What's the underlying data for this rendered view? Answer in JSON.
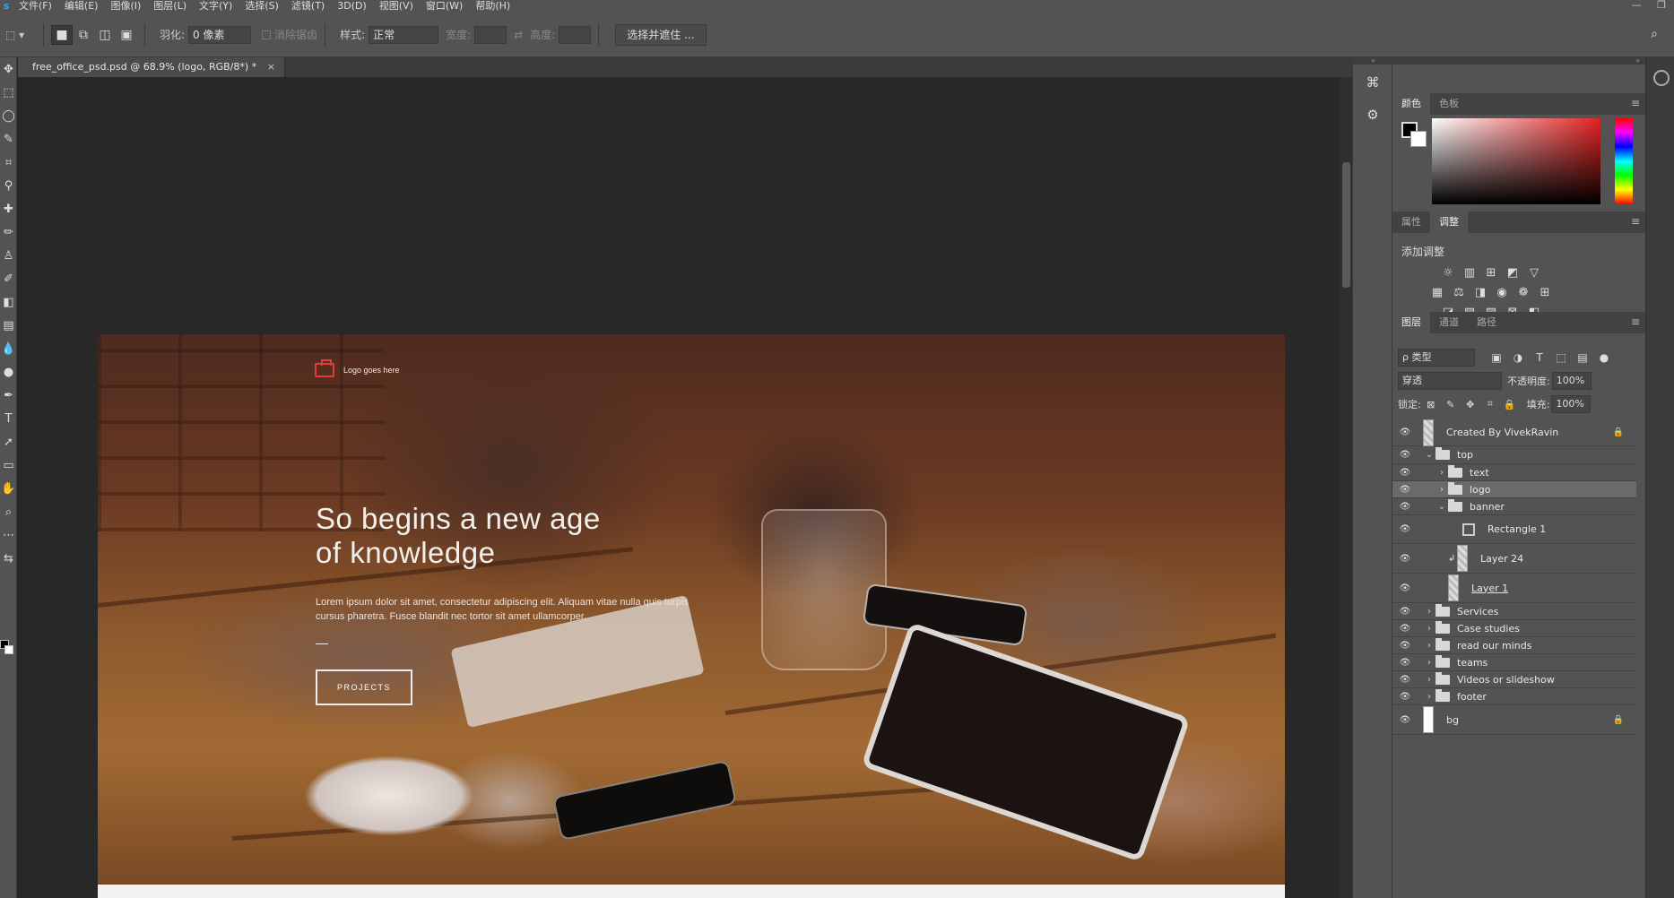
{
  "menu": {
    "logo": "s",
    "items": [
      "文件(F)",
      "编辑(E)",
      "图像(I)",
      "图层(L)",
      "文字(Y)",
      "选择(S)",
      "滤镜(T)",
      "3D(D)",
      "视图(V)",
      "窗口(W)",
      "帮助(H)"
    ],
    "minimize": "—",
    "restore": "❐"
  },
  "options": {
    "feather_label": "羽化:",
    "feather_value": "0 像素",
    "antialias_label": "消除锯齿",
    "style_label": "样式:",
    "style_value": "正常",
    "width_label": "宽度:",
    "height_label": "高度:",
    "select_mask_button": "选择并遮住 ..."
  },
  "document": {
    "tab_title": "free_office_psd.psd @ 68.9% (logo, RGB/8*) *",
    "close": "×"
  },
  "artboard": {
    "logo_text": "Logo goes here",
    "title_line1": "So begins a new age",
    "title_line2": "of knowledge",
    "description": "Lorem ipsum dolor sit amet, consectetur adipiscing elit. Aliquam vitae nulla quis turpis cursus pharetra. Fusce blandit nec tortor sit amet ullamcorper.",
    "button": "PROJECTS"
  },
  "color_panel": {
    "tabs": [
      "颜色",
      "色板"
    ]
  },
  "adjust_panel": {
    "tabs": [
      "属性",
      "调整"
    ],
    "add_label": "添加调整"
  },
  "layers_panel": {
    "tabs": [
      "图层",
      "通道",
      "路径"
    ],
    "filter_kind": "ρ 类型",
    "blend_mode": "穿透",
    "opacity_label": "不透明度:",
    "opacity_value": "100%",
    "lock_label": "锁定:",
    "fill_label": "填充:",
    "fill_value": "100%",
    "layers": [
      {
        "name": "Created By VivekRavin",
        "type": "layer",
        "locked": true,
        "indent": 0,
        "height": 30
      },
      {
        "name": "top",
        "type": "group-open",
        "indent": 0,
        "height": 20
      },
      {
        "name": "text",
        "type": "group",
        "indent": 1,
        "height": 19
      },
      {
        "name": "logo",
        "type": "group",
        "indent": 1,
        "height": 19,
        "selected": true
      },
      {
        "name": "banner",
        "type": "group-open",
        "indent": 1,
        "height": 19
      },
      {
        "name": "Rectangle 1",
        "type": "shape",
        "indent": 2,
        "height": 32
      },
      {
        "name": "Layer 24",
        "type": "clipped",
        "indent": 2,
        "height": 33
      },
      {
        "name": "Layer 1",
        "type": "layer",
        "indent": 2,
        "height": 33,
        "underline": true
      },
      {
        "name": "Services",
        "type": "group",
        "indent": 0,
        "height": 19
      },
      {
        "name": "Case studies",
        "type": "group",
        "indent": 0,
        "height": 19
      },
      {
        "name": "read our minds",
        "type": "group",
        "indent": 0,
        "height": 19
      },
      {
        "name": "teams",
        "type": "group",
        "indent": 0,
        "height": 19
      },
      {
        "name": "Videos or slideshow",
        "type": "group",
        "indent": 0,
        "height": 19
      },
      {
        "name": "footer",
        "type": "group",
        "indent": 0,
        "height": 19
      },
      {
        "name": "bg",
        "type": "layer-white",
        "locked": true,
        "indent": 0,
        "height": 33
      }
    ]
  },
  "colors": {
    "ui_bg": "#535353",
    "canvas_bg": "#282828",
    "accent_red": "#e23b3b"
  }
}
